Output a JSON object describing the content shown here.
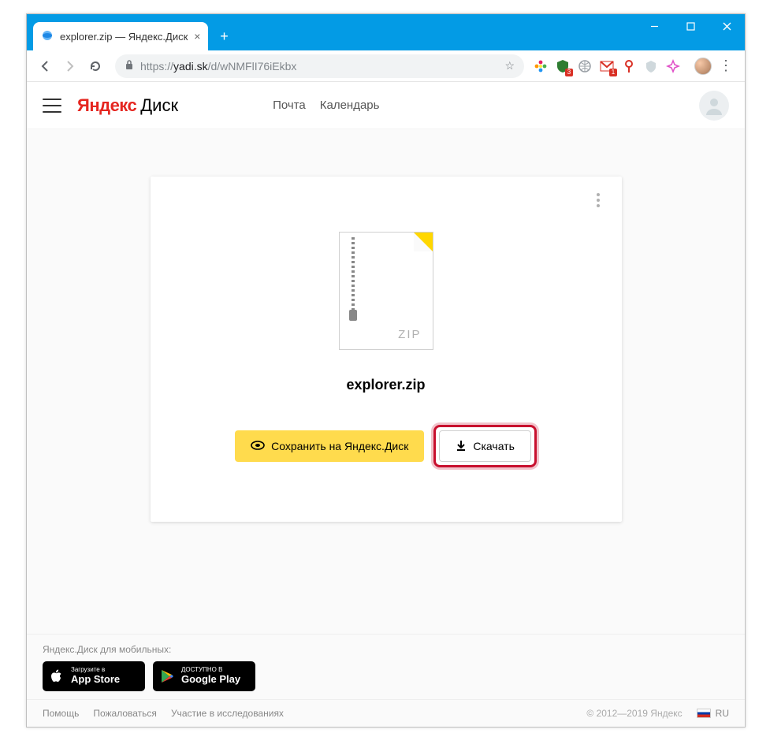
{
  "browser": {
    "tab_title": "explorer.zip — Яндекс.Диск",
    "url_proto": "https://",
    "url_domain": "yadi.sk",
    "url_path": "/d/wNMFlI76iEkbx",
    "ext_badge_shield": "3",
    "ext_badge_gmail": "1"
  },
  "header": {
    "logo_yandex": "Яндекс",
    "logo_disk": "Диск",
    "nav_mail": "Почта",
    "nav_calendar": "Календарь"
  },
  "file": {
    "type_label": "ZIP",
    "name": "explorer.zip",
    "save_button": "Сохранить на Яндекс.Диск",
    "download_button": "Скачать"
  },
  "footer": {
    "mobile_heading": "Яндекс.Диск для мобильных:",
    "appstore_line1": "Загрузите в",
    "appstore_line2": "App Store",
    "gplay_line1": "ДОСТУПНО В",
    "gplay_line2": "Google Play",
    "link_help": "Помощь",
    "link_report": "Пожаловаться",
    "link_research": "Участие в исследованиях",
    "copyright": "© 2012—2019 Яндекс",
    "lang": "RU"
  }
}
